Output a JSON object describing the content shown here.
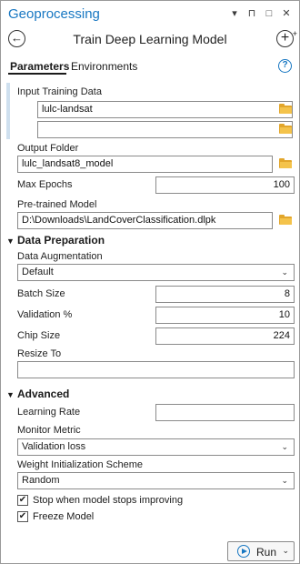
{
  "pane": {
    "title": "Geoprocessing",
    "icons": [
      "chevron-down-icon",
      "pin-icon",
      "maximize-icon",
      "close-icon"
    ]
  },
  "tool": {
    "title": "Train Deep Learning Model"
  },
  "tabs": {
    "parameters": "Parameters",
    "environments": "Environments"
  },
  "params": {
    "input_training_data": {
      "label": "Input Training Data",
      "values": [
        "lulc-landsat",
        ""
      ]
    },
    "output_folder": {
      "label": "Output Folder",
      "value": "lulc_landsat8_model"
    },
    "max_epochs": {
      "label": "Max Epochs",
      "value": "100"
    },
    "pretrained_model": {
      "label": "Pre-trained Model",
      "value": "D:\\Downloads\\LandCoverClassification.dlpk"
    }
  },
  "data_preparation": {
    "title": "Data Preparation",
    "data_augmentation": {
      "label": "Data Augmentation",
      "value": "Default"
    },
    "batch_size": {
      "label": "Batch Size",
      "value": "8"
    },
    "validation_pct": {
      "label": "Validation %",
      "value": "10"
    },
    "chip_size": {
      "label": "Chip Size",
      "value": "224"
    },
    "resize_to": {
      "label": "Resize To",
      "value": ""
    }
  },
  "advanced": {
    "title": "Advanced",
    "learning_rate": {
      "label": "Learning Rate",
      "value": ""
    },
    "monitor_metric": {
      "label": "Monitor Metric",
      "value": "Validation loss"
    },
    "weight_init": {
      "label": "Weight Initialization Scheme",
      "value": "Random"
    },
    "stop_improving": {
      "label": "Stop when model stops improving",
      "checked": true
    },
    "freeze_model": {
      "label": "Freeze Model",
      "checked": true
    }
  },
  "run": {
    "label": "Run"
  },
  "colors": {
    "accent": "#1777c2",
    "folder": "#f4c34b"
  }
}
